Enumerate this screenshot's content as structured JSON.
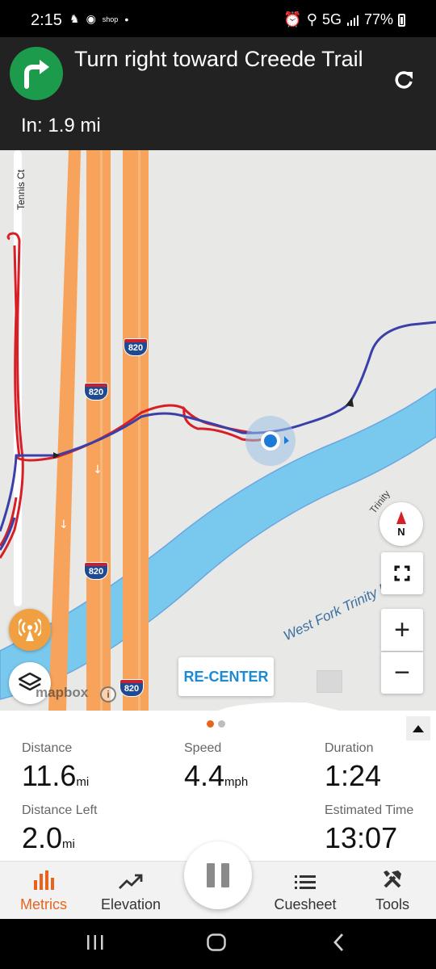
{
  "status_bar": {
    "time": "2:15",
    "shop_label": "shop",
    "network": "5G",
    "battery": "77%"
  },
  "navigation": {
    "instruction": "Turn right toward Creede Trail",
    "distance_label": "In:",
    "distance_value": "1.9 mi",
    "distance_text": "In: 1.9 mi",
    "turn_icon": "turn-right-arrow-icon"
  },
  "map": {
    "street_label": "Tennis Ct",
    "river_label": "West Fork Trinity River",
    "trail_label": "Trinity",
    "highway_shields": [
      "820",
      "820",
      "820",
      "820"
    ],
    "compass_label": "N",
    "recenter_label": "RE-CENTER",
    "attribution": "mapbox",
    "info_label": "i",
    "zoom_in": "+",
    "zoom_out": "−",
    "colors": {
      "route_blue": "#3b3fa8",
      "track_red": "#d61f26",
      "highway_orange": "#f7a35c",
      "river": "#79c9ef",
      "land": "#e8e8e6"
    }
  },
  "metrics": {
    "distance": {
      "label": "Distance",
      "value": "11.6",
      "unit": "mi"
    },
    "speed": {
      "label": "Speed",
      "value": "4.4",
      "unit": "mph"
    },
    "duration": {
      "label": "Duration",
      "value": "1:24"
    },
    "distance_left": {
      "label": "Distance Left",
      "value": "2.0",
      "unit": "mi"
    },
    "estimated_time": {
      "label": "Estimated Time",
      "value": "13:07"
    },
    "dot_colors": [
      "#e8641e",
      "#bdbdbd"
    ]
  },
  "tabs": [
    {
      "label": "Metrics",
      "icon": "bar-chart-icon",
      "active": true
    },
    {
      "label": "Elevation",
      "icon": "trend-line-icon",
      "active": false
    },
    {
      "label": "Cuesheet",
      "icon": "list-icon",
      "active": false
    },
    {
      "label": "Tools",
      "icon": "tools-icon",
      "active": false
    }
  ],
  "accent_color": "#e8641e"
}
